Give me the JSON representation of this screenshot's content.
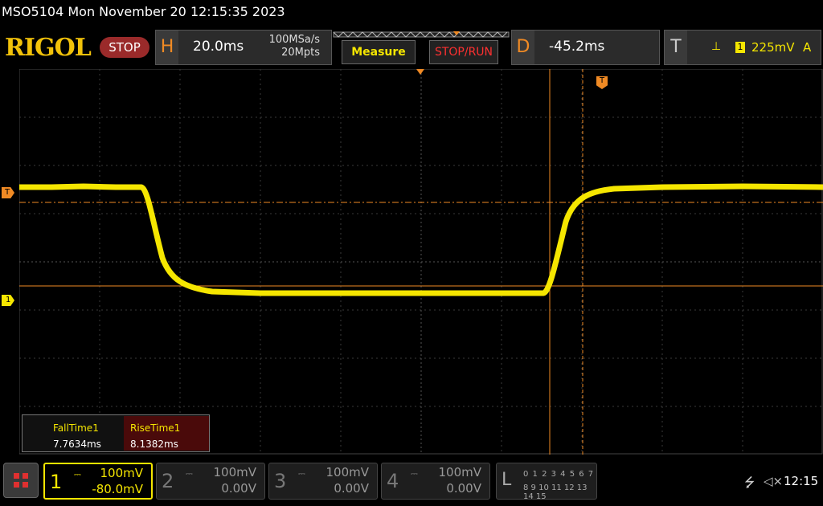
{
  "window": {
    "title": "MSO5104  Mon November 20 12:15:35 2023"
  },
  "brand": {
    "logo": "RIGOL",
    "run_state": "STOP"
  },
  "horizontal": {
    "letter": "H",
    "timebase": "20.0ms",
    "sample_rate": "100MSa/s",
    "memory_depth": "20Mpts"
  },
  "buttons": {
    "measure": "Measure",
    "stop_run": "STOP/RUN"
  },
  "delay": {
    "letter": "D",
    "value": "-45.2ms"
  },
  "trigger": {
    "letter": "T",
    "edge_icon": "rising-edge-icon",
    "edge_glyph": "⊥",
    "source": "1",
    "level": "225mV",
    "mode": "A"
  },
  "markers": {
    "trigger_level": "T",
    "channel1": "1",
    "trigger_position": "T"
  },
  "measurements": [
    {
      "label": "FallTime1",
      "value": "7.7634ms"
    },
    {
      "label": "RiseTime1",
      "value": "8.1382ms"
    }
  ],
  "channels": [
    {
      "number": "1",
      "coupling": "DC",
      "scale": "100mV",
      "offset": "-80.0mV",
      "active": true
    },
    {
      "number": "2",
      "coupling": "DC",
      "scale": "100mV",
      "offset": "0.00V",
      "active": false
    },
    {
      "number": "3",
      "coupling": "DC",
      "scale": "100mV",
      "offset": "0.00V",
      "active": false
    },
    {
      "number": "4",
      "coupling": "DC",
      "scale": "100mV",
      "offset": "0.00V",
      "active": false
    }
  ],
  "logic": {
    "letter": "L",
    "row1": "0 1 2 3  4 5 6 7",
    "row2": "8 9 10 11 12 13 14 15"
  },
  "status": {
    "usb_icon": "usb-icon",
    "sound_icon": "sound-muted-icon",
    "time": "12:15"
  },
  "colors": {
    "ch1": "#f5e600",
    "accent": "#f08a24",
    "stop": "#ff3030"
  }
}
